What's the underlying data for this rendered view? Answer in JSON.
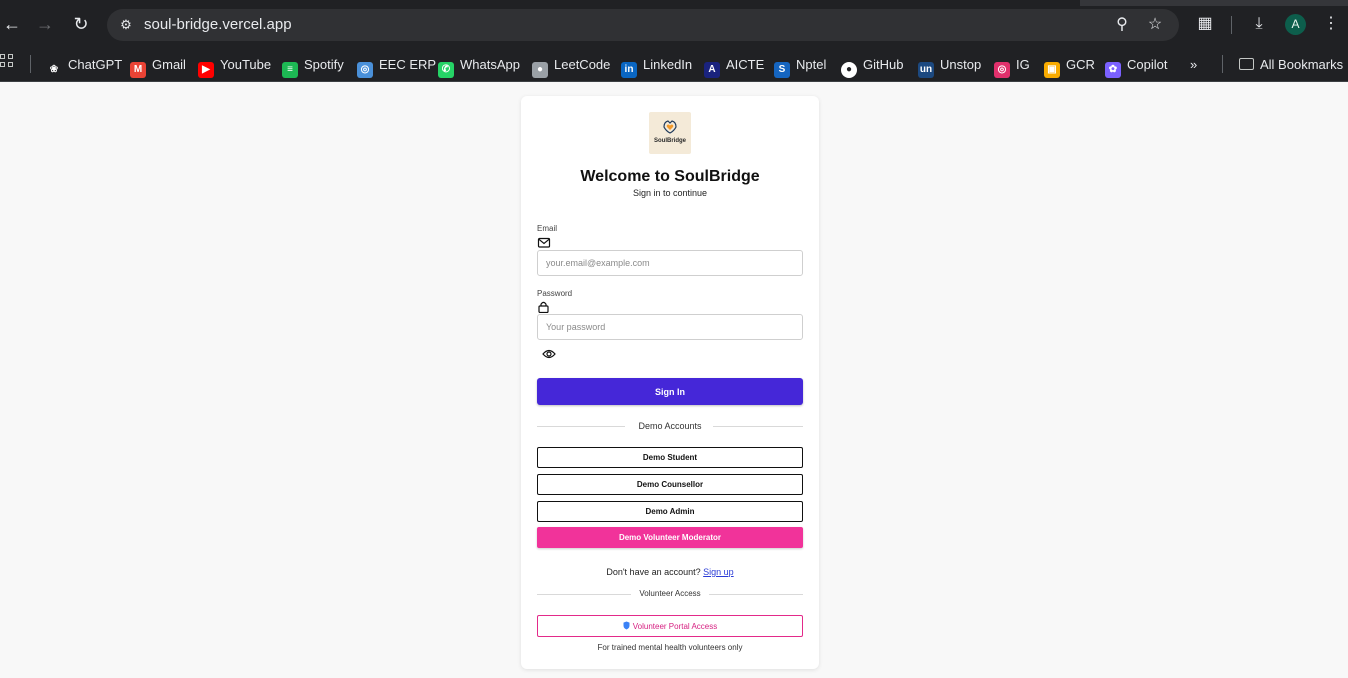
{
  "browser": {
    "url": "soul-bridge.vercel.app",
    "profile_initial": "A",
    "bookmarks": [
      {
        "label": "ChatGPT",
        "icon": "chatgpt-icon",
        "color": "#202124"
      },
      {
        "label": "Gmail",
        "icon": "gmail-icon",
        "color": "#ea4335"
      },
      {
        "label": "YouTube",
        "icon": "youtube-icon",
        "color": "#ff0000"
      },
      {
        "label": "Spotify",
        "icon": "spotify-icon",
        "color": "#1db954"
      },
      {
        "label": "EEC ERP",
        "icon": "erp-icon",
        "color": "#4a90d9"
      },
      {
        "label": "WhatsApp",
        "icon": "whatsapp-icon",
        "color": "#25d366"
      },
      {
        "label": "LeetCode",
        "icon": "globe-icon",
        "color": "#9aa0a6"
      },
      {
        "label": "LinkedIn",
        "icon": "linkedin-icon",
        "color": "#0a66c2"
      },
      {
        "label": "AICTE",
        "icon": "aicte-icon",
        "color": "#1a237e"
      },
      {
        "label": "Nptel",
        "icon": "nptel-icon",
        "color": "#1565c0"
      },
      {
        "label": "GitHub",
        "icon": "github-icon",
        "color": "#ffffff"
      },
      {
        "label": "Unstop",
        "icon": "unstop-icon",
        "color": "#1c4980"
      },
      {
        "label": "IG",
        "icon": "instagram-icon",
        "color": "#e1306c"
      },
      {
        "label": "GCR",
        "icon": "classroom-icon",
        "color": "#f9ab00"
      },
      {
        "label": "Copilot",
        "icon": "copilot-icon",
        "color": "#7b61ff"
      }
    ],
    "all_bookmarks_label": "All Bookmarks"
  },
  "login": {
    "logo_text": "SoulBridge",
    "title": "Welcome to SoulBridge",
    "subtitle": "Sign in to continue",
    "email_label": "Email",
    "email_placeholder": "your.email@example.com",
    "password_label": "Password",
    "password_placeholder": "Your password",
    "signin_label": "Sign In",
    "demo_divider": "Demo Accounts",
    "demo_buttons": [
      "Demo Student",
      "Demo Counsellor",
      "Demo Admin",
      "Demo Volunteer Moderator"
    ],
    "signup_prompt": "Don't have an account?",
    "signup_link": "Sign up",
    "volunteer_divider": "Volunteer Access",
    "volunteer_button": "Volunteer Portal Access",
    "volunteer_note": "For trained mental health volunteers only"
  },
  "colors": {
    "primary": "#4527d8",
    "accent_pink": "#f1339a",
    "page_bg": "#f8f8f8"
  }
}
